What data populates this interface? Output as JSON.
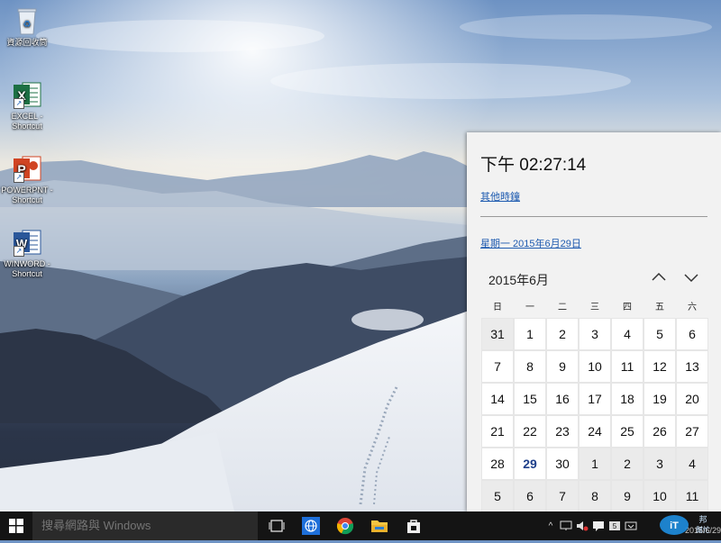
{
  "desktop": {
    "icons": [
      {
        "label": "資源回收筒",
        "icon": "recycle-bin-icon"
      },
      {
        "label": "EXCEL - Shortcut",
        "icon": "excel-icon",
        "letter": "X",
        "color": "#1d7044"
      },
      {
        "label": "POWERPNT - Shortcut",
        "icon": "powerpoint-icon",
        "letter": "P",
        "color": "#d04423"
      },
      {
        "label": "WINWORD - Shortcut",
        "icon": "word-icon",
        "letter": "W",
        "color": "#2b579a"
      }
    ]
  },
  "flyout": {
    "time": "下午 02:27:14",
    "other_clocks_link": "其他時鐘",
    "date_link": "星期一 2015年6月29日",
    "month_label": "2015年6月",
    "weekdays": [
      "日",
      "一",
      "二",
      "三",
      "四",
      "五",
      "六"
    ],
    "days": [
      [
        "31",
        "1",
        "2",
        "3",
        "4",
        "5",
        "6"
      ],
      [
        "7",
        "8",
        "9",
        "10",
        "11",
        "12",
        "13"
      ],
      [
        "14",
        "15",
        "16",
        "17",
        "18",
        "19",
        "20"
      ],
      [
        "21",
        "22",
        "23",
        "24",
        "25",
        "26",
        "27"
      ],
      [
        "28",
        "29",
        "30",
        "1",
        "2",
        "3",
        "4"
      ],
      [
        "5",
        "6",
        "7",
        "8",
        "9",
        "10",
        "11"
      ]
    ],
    "today": "29",
    "accent": "#1e3f8a"
  },
  "taskbar": {
    "search_placeholder": "搜尋網路與 Windows",
    "date": "2015/6/29",
    "watermark": "iT邦幫忙"
  }
}
